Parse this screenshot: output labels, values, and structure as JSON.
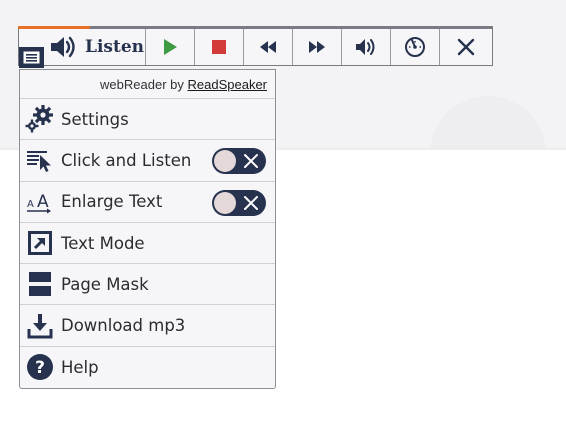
{
  "toolbar": {
    "listen_label": "Listen",
    "buttons": [
      {
        "name": "play-button",
        "icon": "play-icon"
      },
      {
        "name": "stop-button",
        "icon": "stop-icon"
      },
      {
        "name": "rewind-button",
        "icon": "rewind-icon"
      },
      {
        "name": "fast-forward-button",
        "icon": "fast-forward-icon"
      },
      {
        "name": "volume-button",
        "icon": "volume-icon"
      },
      {
        "name": "speed-button",
        "icon": "speedometer-icon"
      },
      {
        "name": "close-button",
        "icon": "close-icon"
      }
    ],
    "colors": {
      "accent": "#27324e",
      "play": "#3f9a46",
      "stop": "#d33a3a",
      "progress": "#e8702a"
    }
  },
  "menu": {
    "header_prefix": "webReader by ",
    "header_brand": "ReadSpeaker",
    "items": [
      {
        "label": "Settings",
        "icon": "gears-icon"
      },
      {
        "label": "Click and Listen",
        "icon": "click-listen-icon",
        "toggle": false
      },
      {
        "label": "Enlarge Text",
        "icon": "enlarge-text-icon",
        "toggle": false
      },
      {
        "label": "Text Mode",
        "icon": "text-mode-icon"
      },
      {
        "label": "Page Mask",
        "icon": "page-mask-icon"
      },
      {
        "label": "Download mp3",
        "icon": "download-icon"
      },
      {
        "label": "Help",
        "icon": "help-icon"
      }
    ]
  }
}
